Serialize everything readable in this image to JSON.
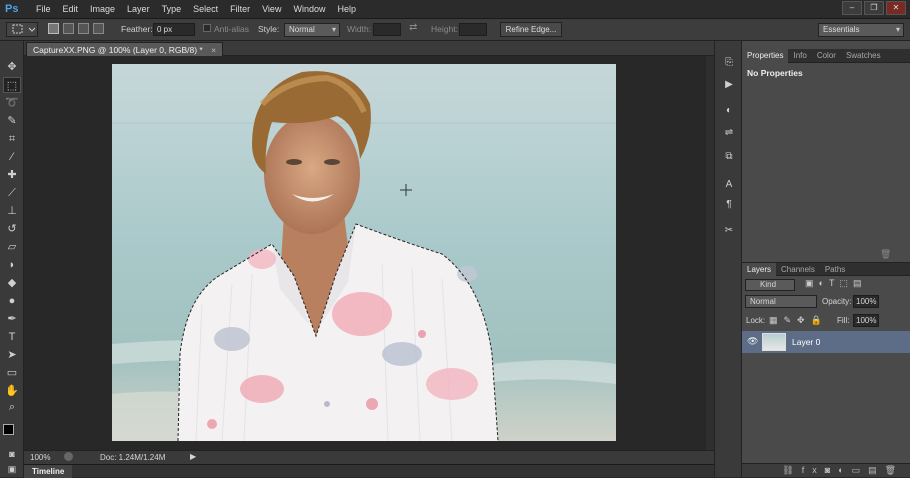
{
  "app": {
    "logo": "Ps"
  },
  "menu": [
    "File",
    "Edit",
    "Image",
    "Layer",
    "Type",
    "Select",
    "Filter",
    "View",
    "Window",
    "Help"
  ],
  "window_controls": [
    "–",
    "❐",
    "✕"
  ],
  "options": {
    "feather_label": "Feather:",
    "feather_value": "0 px",
    "antialias_label": "Anti-alias",
    "style_label": "Style:",
    "style_value": "Normal",
    "width_label": "Width:",
    "height_label": "Height:",
    "refine_edge_label": "Refine Edge...",
    "workspace_value": "Essentials"
  },
  "document": {
    "tab_label": "CaptureXX.PNG @ 100% (Layer 0, RGB/8) *",
    "close": "×"
  },
  "status": {
    "zoom": "100%",
    "doc_info": "Doc: 1.24M/1.24M"
  },
  "timeline_label": "Timeline",
  "properties_panel": {
    "tabs": [
      "Properties",
      "Info",
      "Color",
      "Swatches"
    ],
    "content": "No Properties"
  },
  "layers_panel": {
    "tabs": [
      "Layers",
      "Channels",
      "Paths"
    ],
    "filter_value": "Kind",
    "blend_mode": "Normal",
    "opacity_label": "Opacity:",
    "opacity_value": "100%",
    "lock_label": "Lock:",
    "fill_label": "Fill:",
    "fill_value": "100%",
    "layers": [
      {
        "name": "Layer 0",
        "visible": true
      }
    ]
  },
  "accent": "#4ea3e6"
}
